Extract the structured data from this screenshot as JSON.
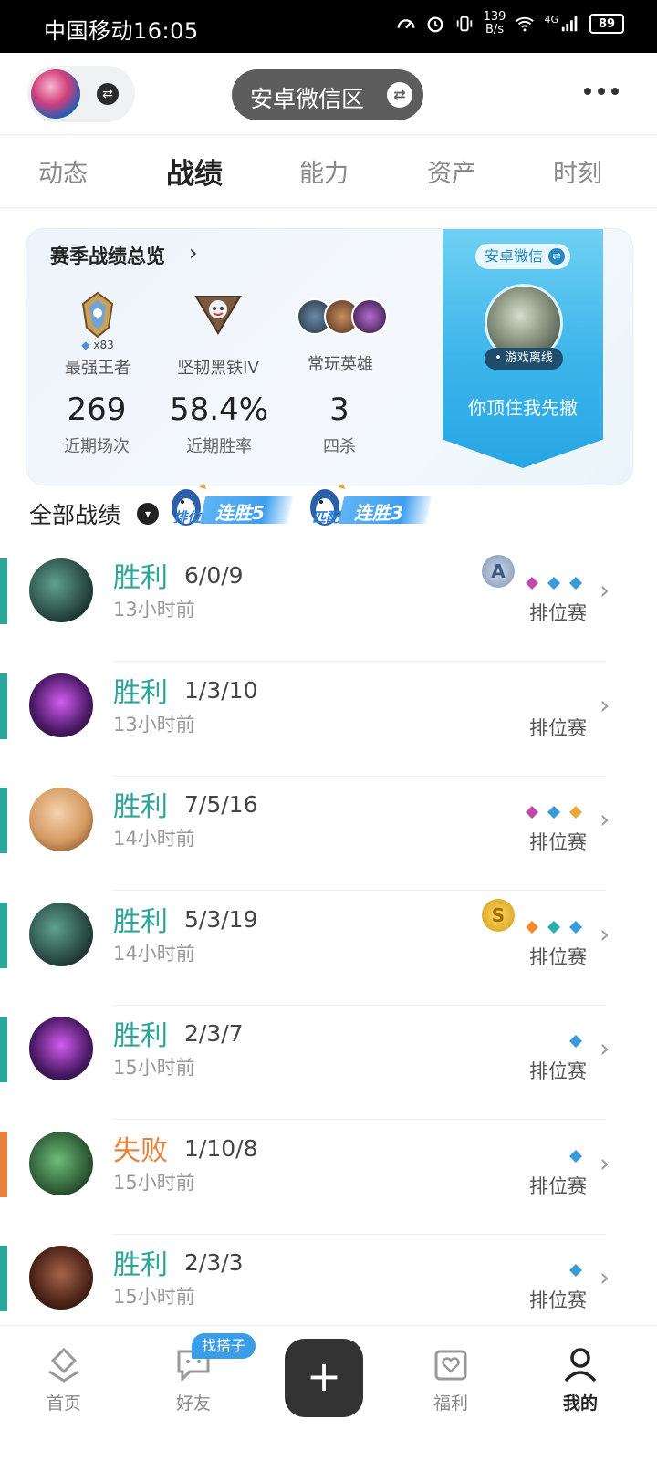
{
  "status_bar": {
    "carrier_time": "中国移动16:05",
    "net_speed_top": "139",
    "net_speed_bottom": "B/s",
    "network": "4G",
    "battery": "89"
  },
  "header": {
    "server_label": "安卓微信区",
    "avatar_icon": "champion-avatar",
    "more_icon": "more-dots-icon"
  },
  "tabs": [
    {
      "label": "动态",
      "active": false
    },
    {
      "label": "战绩",
      "active": true
    },
    {
      "label": "能力",
      "active": false
    },
    {
      "label": "资产",
      "active": false
    },
    {
      "label": "时刻",
      "active": false
    }
  ],
  "season": {
    "title": "赛季战绩总览",
    "ranks": [
      {
        "label": "最强王者",
        "sub": "x83"
      },
      {
        "label": "坚韧黑铁IV"
      },
      {
        "label": "常玩英雄"
      }
    ],
    "stats": [
      {
        "value": "269",
        "label": "近期场次"
      },
      {
        "value": "58.4%",
        "label": "近期胜率"
      },
      {
        "value": "3",
        "label": "四杀"
      }
    ],
    "banner": {
      "server": "安卓微信",
      "status": "游戏离线",
      "name": "你顶住我先撤"
    }
  },
  "records": {
    "title": "全部战绩",
    "streaks": [
      {
        "type": "排位",
        "text": "连胜5"
      },
      {
        "type": "匹配",
        "text": "连胜3"
      }
    ]
  },
  "matches": [
    {
      "result": "胜利",
      "kda": "6/0/9",
      "time": "13小时前",
      "mode": "排位赛",
      "outcome": "win",
      "medal": "A"
    },
    {
      "result": "胜利",
      "kda": "1/3/10",
      "time": "13小时前",
      "mode": "排位赛",
      "outcome": "win"
    },
    {
      "result": "胜利",
      "kda": "7/5/16",
      "time": "14小时前",
      "mode": "排位赛",
      "outcome": "win"
    },
    {
      "result": "胜利",
      "kda": "5/3/19",
      "time": "14小时前",
      "mode": "排位赛",
      "outcome": "win",
      "medal": "S"
    },
    {
      "result": "胜利",
      "kda": "2/3/7",
      "time": "15小时前",
      "mode": "排位赛",
      "outcome": "win"
    },
    {
      "result": "失败",
      "kda": "1/10/8",
      "time": "15小时前",
      "mode": "排位赛",
      "outcome": "loss"
    },
    {
      "result": "胜利",
      "kda": "2/3/3",
      "time": "15小时前",
      "mode": "排位赛",
      "outcome": "win"
    }
  ],
  "colors": {
    "win": "#2aa69b",
    "loss": "#e8823a",
    "accent_blue": "#3cb4ea"
  },
  "bottom_nav": {
    "items": [
      {
        "label": "首页"
      },
      {
        "label": "好友",
        "badge": "找搭子"
      },
      {
        "label": "福利"
      },
      {
        "label": "我的"
      }
    ],
    "plus_label": "+"
  }
}
